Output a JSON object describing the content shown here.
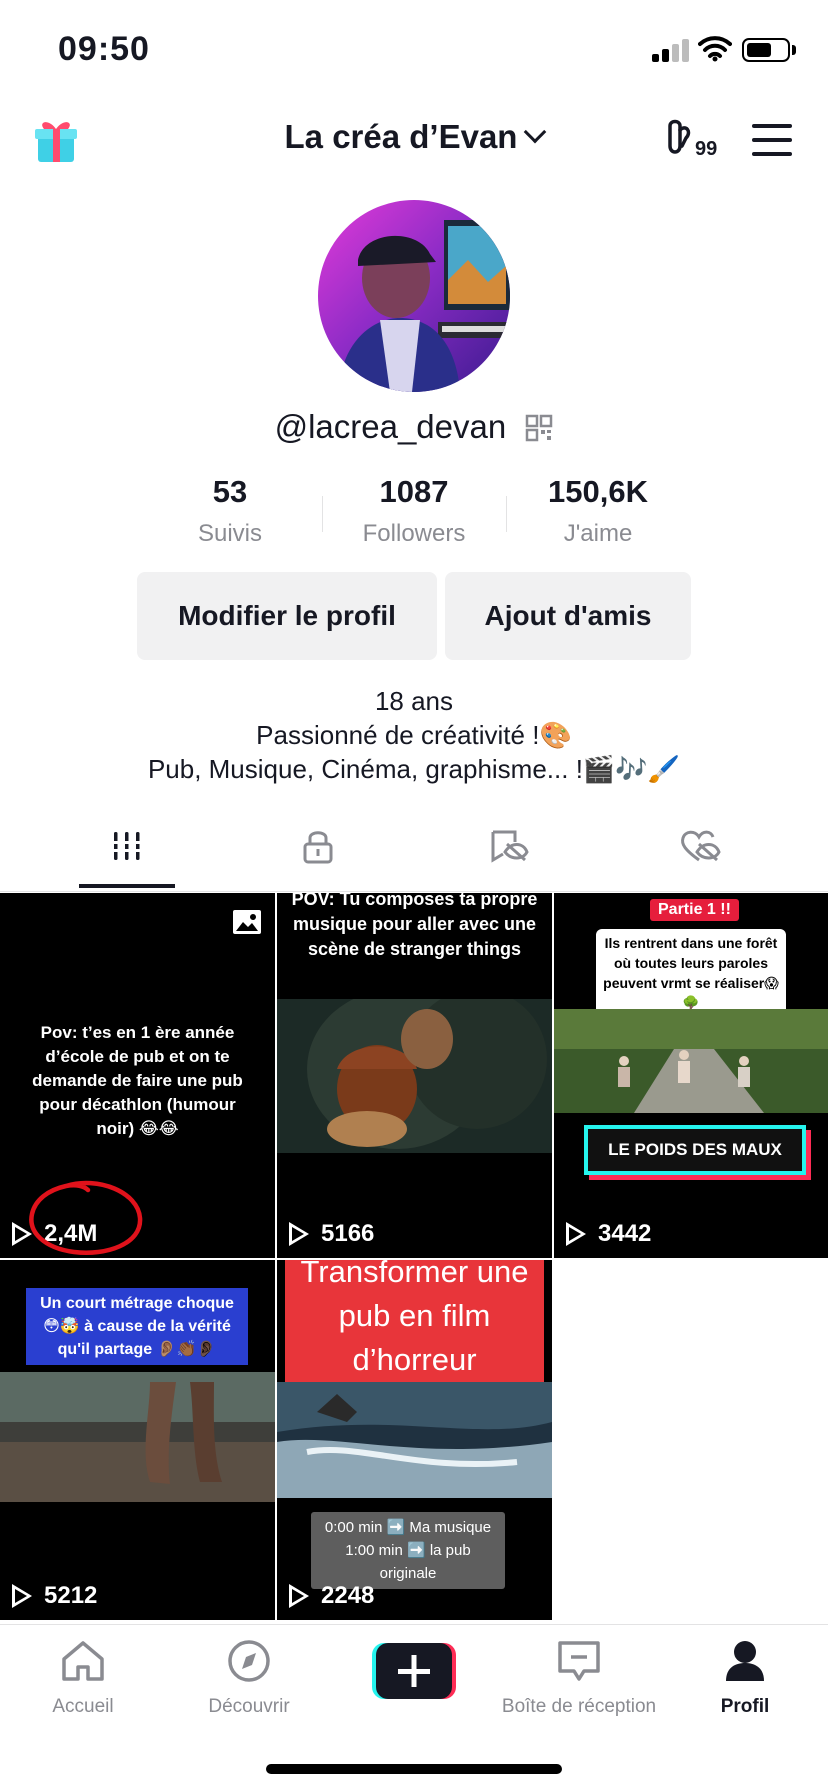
{
  "status_bar": {
    "time": "09:50"
  },
  "header": {
    "title": "La créa d’Evan",
    "creator_badge_count": "99"
  },
  "profile": {
    "username": "@lacrea_devan",
    "stats": [
      {
        "value": "53",
        "label": "Suivis"
      },
      {
        "value": "1087",
        "label": "Followers"
      },
      {
        "value": "150,6K",
        "label": "J'aime"
      }
    ],
    "buttons": {
      "edit": "Modifier le profil",
      "add_friends": "Ajout d'amis"
    },
    "bio": [
      "18 ans",
      "Passionné de créativité !🎨",
      "Pub, Musique, Cinéma, graphisme... !🎬🎶🖌️"
    ]
  },
  "tabs": [
    "videos-grid-icon",
    "lock-icon",
    "hidden-icon",
    "liked-hidden-icon"
  ],
  "videos": [
    {
      "caption": "Pov: t’es en 1 ère année d’école de pub et on te demande de faire une pub pour décathlon (humour noir) 😂😂",
      "views": "2,4M"
    },
    {
      "caption": "POV: Tu composes ta propre musique pour aller avec une scène de stranger things",
      "views": "5166"
    },
    {
      "badge": "Partie 1 !!",
      "caption": "Ils rentrent dans une forêt où toutes leurs paroles peuvent vrmt se réaliser😱🌳",
      "title_card": "LE POIDS DES MAUX",
      "views": "3442"
    },
    {
      "caption": "Un court métrage choque😳🤯 à cause de la vérité qu'il partage 👂🏽👏🏾👂🏿",
      "views": "5212"
    },
    {
      "caption": "Transformer une pub en film d’horreur",
      "overlay_lines": [
        "0:00 min ➡️ Ma musique",
        "1:00 min ➡️ la pub",
        "originale"
      ],
      "views": "2248"
    }
  ],
  "bottom_nav": [
    {
      "label": "Accueil",
      "icon": "home-icon"
    },
    {
      "label": "Découvrir",
      "icon": "compass-icon"
    },
    {
      "label": "",
      "icon": "create-plus-icon"
    },
    {
      "label": "Boîte de réception",
      "icon": "inbox-icon"
    },
    {
      "label": "Profil",
      "icon": "profile-icon"
    }
  ],
  "colors": {
    "accent_red": "#fe2c55",
    "accent_cyan": "#25f4ee",
    "annotation_red": "#e0121b"
  }
}
